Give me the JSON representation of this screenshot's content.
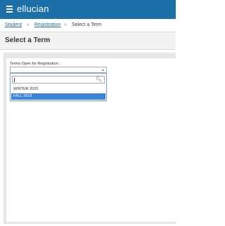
{
  "header": {
    "logo_text": "ellucian",
    "menu_icon": "hamburger-menu-icon"
  },
  "breadcrumb": {
    "items": [
      "Student",
      "Registration",
      "Select a Term"
    ],
    "separator": "»"
  },
  "page": {
    "title": "Select a Term"
  },
  "form": {
    "terms_label": "Terms Open for Registration",
    "search_icon": "search-icon",
    "options": [
      "WINTER 2020",
      "FALL 2019"
    ],
    "highlighted_option": "FALL 2019"
  },
  "colors": {
    "header_bg": "#1d6fa8",
    "link": "#1d6fa8",
    "highlight": "#3b82d8"
  }
}
